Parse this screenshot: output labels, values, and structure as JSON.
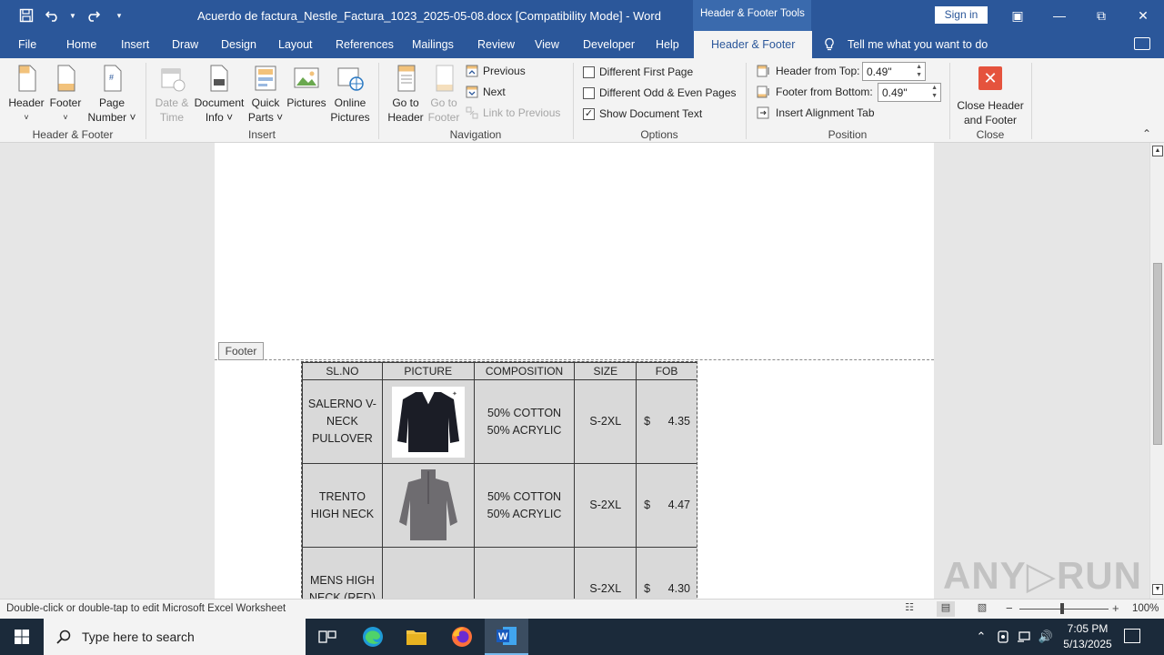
{
  "titlebar": {
    "title": "Acuerdo de factura_Nestle_Factura_1023_2025-05-08.docx [Compatibility Mode]  -  Word",
    "context_label": "Header & Footer Tools",
    "signin": "Sign in",
    "minimize": "—",
    "restore": "⧉",
    "close": "✕",
    "ribbon_display": "▣"
  },
  "tabs": {
    "file": "File",
    "home": "Home",
    "insert": "Insert",
    "draw": "Draw",
    "design": "Design",
    "layout": "Layout",
    "references": "References",
    "mailings": "Mailings",
    "review": "Review",
    "view": "View",
    "developer": "Developer",
    "help": "Help",
    "header_footer": "Header & Footer",
    "tell_me": "Tell me what you want to do"
  },
  "ribbon": {
    "groups": {
      "header_footer": "Header & Footer",
      "insert": "Insert",
      "navigation": "Navigation",
      "options": "Options",
      "position": "Position",
      "close": "Close"
    },
    "header": {
      "line1": "Header",
      "line2": "˅"
    },
    "footer": {
      "line1": "Footer",
      "line2": "˅"
    },
    "page_number": {
      "line1": "Page",
      "line2": "Number ˅"
    },
    "date_time": {
      "line1": "Date &",
      "line2": "Time"
    },
    "document_info": {
      "line1": "Document",
      "line2": "Info ˅"
    },
    "quick_parts": {
      "line1": "Quick",
      "line2": "Parts ˅"
    },
    "pictures": {
      "line1": "Pictures"
    },
    "online_pictures": {
      "line1": "Online",
      "line2": "Pictures"
    },
    "go_to_header": {
      "line1": "Go to",
      "line2": "Header"
    },
    "go_to_footer": {
      "line1": "Go to",
      "line2": "Footer"
    },
    "previous": "Previous",
    "next": "Next",
    "link_to_previous": "Link to Previous",
    "different_first_page": "Different First Page",
    "different_first_page_checked": false,
    "different_odd_even": "Different Odd & Even Pages",
    "different_odd_even_checked": false,
    "show_document_text": "Show Document Text",
    "show_document_text_checked": true,
    "header_from_top_label": "Header from Top:",
    "header_from_top_value": "0.49\"",
    "footer_from_bottom_label": "Footer from Bottom:",
    "footer_from_bottom_value": "0.49\"",
    "insert_alignment_tab": "Insert Alignment Tab",
    "close_header": {
      "line1": "Close Header",
      "line2": "and Footer"
    }
  },
  "document": {
    "footer_tag": "Footer",
    "table": {
      "headers": [
        "SL.NO",
        "PICTURE",
        "COMPOSITION",
        "SIZE",
        "FOB"
      ],
      "rows": [
        {
          "name_lines": [
            "SALERNO V-",
            "NECK",
            "PULLOVER"
          ],
          "picture": "navy-pullover",
          "composition": [
            "50% COTTON",
            "50% ACRYLIC"
          ],
          "size": "S-2XL",
          "currency": "$",
          "price": "4.35"
        },
        {
          "name_lines": [
            "TRENTO",
            "HIGH NECK"
          ],
          "picture": "grey-high-neck",
          "composition": [
            "50% COTTON",
            "50% ACRYLIC"
          ],
          "size": "S-2XL",
          "currency": "$",
          "price": "4.47"
        },
        {
          "name_lines": [
            "MENS HIGH",
            "NECK (RED)"
          ],
          "picture": "",
          "composition": [],
          "size": "S-2XL",
          "currency": "$",
          "price": "4.30"
        }
      ]
    }
  },
  "statusbar": {
    "message": "Double-click or double-tap to edit Microsoft Excel Worksheet",
    "zoom": "100%",
    "zoom_minus": "−",
    "zoom_plus": "+"
  },
  "taskbar": {
    "search_placeholder": "Type here to search",
    "time": "7:05 PM",
    "date": "5/13/2025"
  },
  "watermark": "ANY▷RUN",
  "colors": {
    "word_blue": "#2b579a",
    "ribbon_bg": "#f3f3f3",
    "close_red": "#e5533d",
    "sheet_bg": "#d9d9d9"
  }
}
